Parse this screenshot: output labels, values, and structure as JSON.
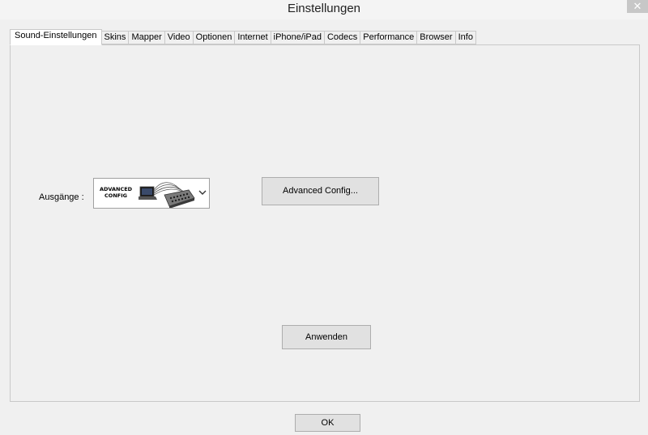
{
  "window": {
    "title": "Einstellungen",
    "close_glyph": "✕"
  },
  "tabs": [
    {
      "label": "Sound-Einstellungen",
      "active": true
    },
    {
      "label": "Skins",
      "active": false
    },
    {
      "label": "Mapper",
      "active": false
    },
    {
      "label": "Video",
      "active": false
    },
    {
      "label": "Optionen",
      "active": false
    },
    {
      "label": "Internet",
      "active": false
    },
    {
      "label": "iPhone/iPad",
      "active": false
    },
    {
      "label": "Codecs",
      "active": false
    },
    {
      "label": "Performance",
      "active": false
    },
    {
      "label": "Browser",
      "active": false
    },
    {
      "label": "Info",
      "active": false
    }
  ],
  "sound": {
    "output_label": "Ausgänge :",
    "output_selected": {
      "logo_line1": "ADVANCED",
      "logo_line2": "CONFIG",
      "icons": [
        "laptop-icon",
        "mixer-icon",
        "chevron-down-icon"
      ]
    },
    "advanced_button": "Advanced Config...",
    "apply_button": "Anwenden"
  },
  "footer": {
    "ok_button": "OK"
  },
  "colors": {
    "window_bg": "#f0f0f0",
    "active_tab_bg": "#ffffff",
    "button_bg": "#e1e1e1",
    "border": "#c9c9c9"
  }
}
